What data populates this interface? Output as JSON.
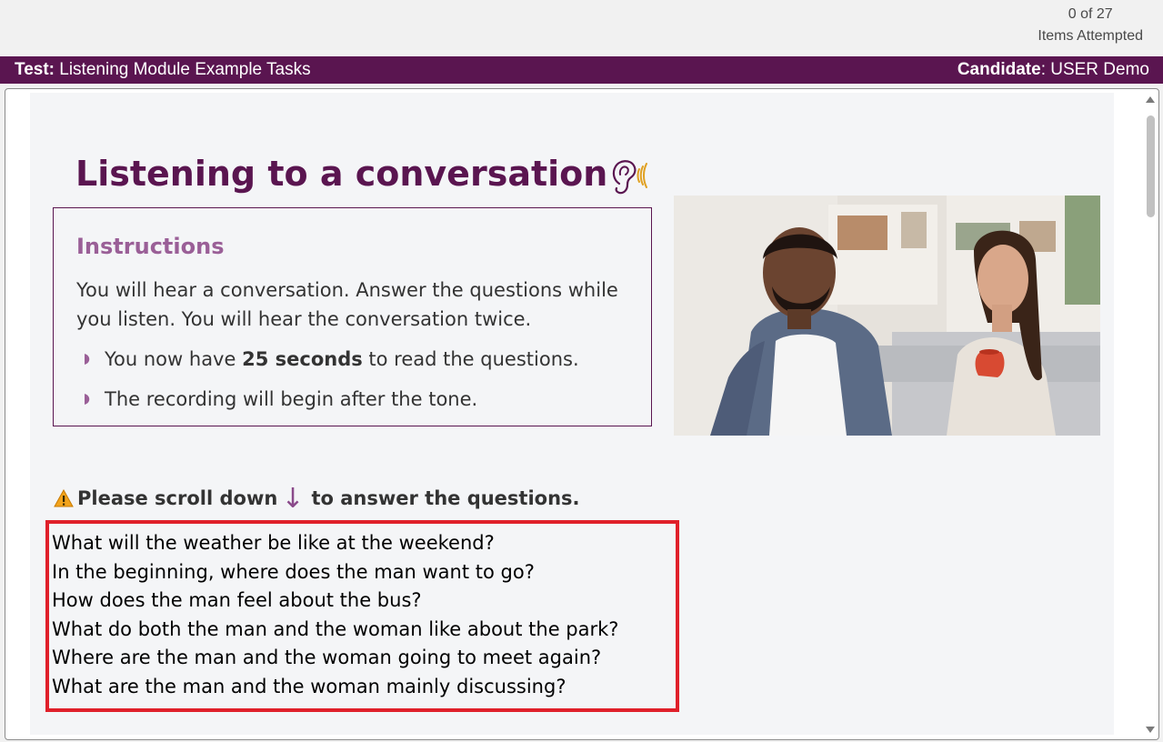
{
  "header": {
    "items_count": "0 of 27",
    "items_caption": "Items Attempted"
  },
  "title_bar": {
    "test_label": "Test:",
    "test_name": "Listening Module Example Tasks",
    "candidate_label": "Candidate",
    "candidate_name": ": USER Demo"
  },
  "page": {
    "title": "Listening to a conversation",
    "title_icon": "ear-listening-icon"
  },
  "instructions": {
    "heading": "Instructions",
    "body": "You will hear a conversation. Answer the questions while you listen. You will hear the conversation twice.",
    "bullets": [
      {
        "before": "You now have ",
        "bold": "25 seconds",
        "after": " to read the questions."
      },
      {
        "before": "The recording will begin after the tone.",
        "bold": "",
        "after": ""
      }
    ]
  },
  "scroll_note": {
    "before": "Please scroll down",
    "arrow": "↓",
    "after": "to answer the questions."
  },
  "questions": [
    "What will the weather be like at the weekend?",
    "In the beginning, where does the man want to go?",
    "How does the man feel about the bus?",
    "What do both the man and the woman like about the park?",
    "Where are the man and the woman going to meet again?",
    "What are the man and the woman mainly discussing?"
  ],
  "colors": {
    "brand": "#5a1550",
    "instructions_heading": "#9a5f97",
    "highlight_border": "#e0202a",
    "icon_accent": "#e0a020"
  }
}
